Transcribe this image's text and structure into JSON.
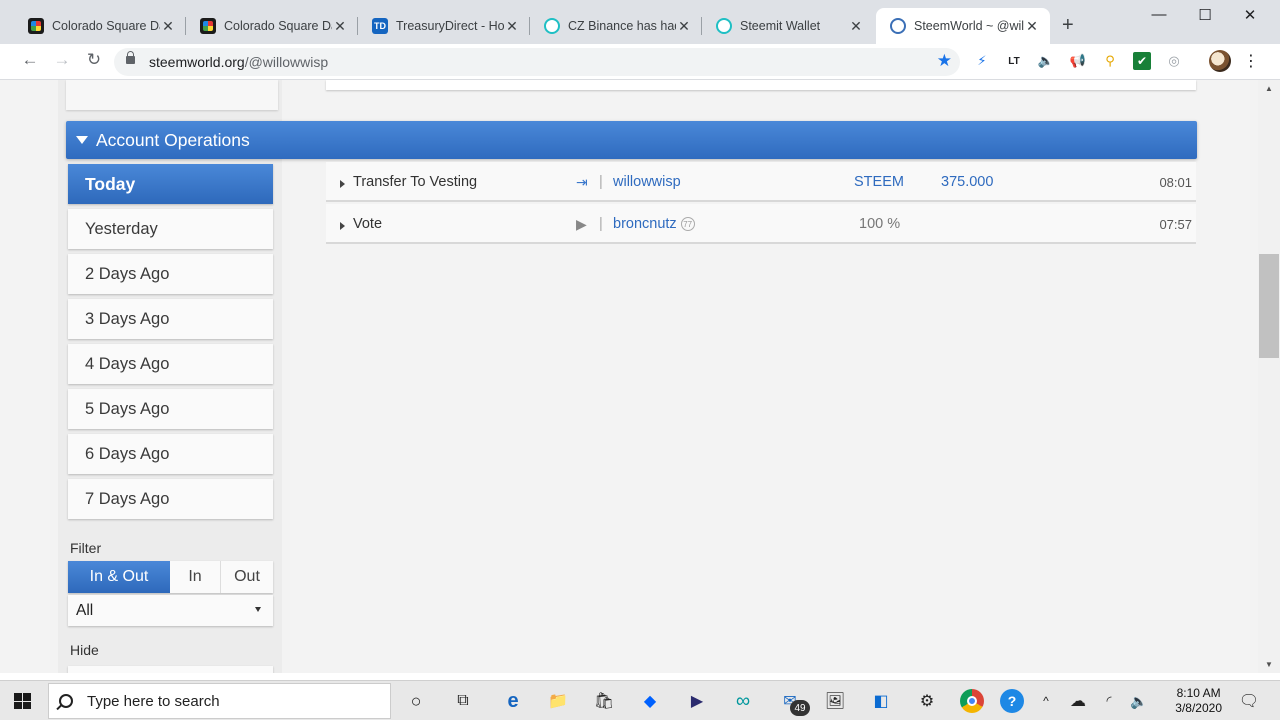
{
  "browser": {
    "tabs": [
      {
        "title": "Colorado Square Da",
        "favicon": "csd"
      },
      {
        "title": "Colorado Square Da",
        "favicon": "csd"
      },
      {
        "title": "TreasuryDirect - Hor",
        "favicon": "td"
      },
      {
        "title": "CZ Binance has had",
        "favicon": "steem"
      },
      {
        "title": "Steemit Wallet",
        "favicon": "steem"
      },
      {
        "title": "SteemWorld ~ @will",
        "favicon": "sw",
        "active": true
      }
    ],
    "td_badge": "TD",
    "url_host": "steemworld.org",
    "url_path": "/@willowwisp"
  },
  "page": {
    "section_title": "Account Operations",
    "days": [
      "Today",
      "Yesterday",
      "2 Days Ago",
      "3 Days Ago",
      "4 Days Ago",
      "5 Days Ago",
      "6 Days Ago",
      "7 Days Ago"
    ],
    "filter_label": "Filter",
    "filter_segments": [
      "In & Out",
      "In",
      "Out"
    ],
    "filter_select": "All",
    "hide_label": "Hide",
    "operations": [
      {
        "type": "Transfer To Vesting",
        "account": "willowwisp",
        "asset": "STEEM",
        "amount": "375.000",
        "time": "08:01"
      },
      {
        "type": "Vote",
        "account": "broncnutz",
        "reputation": "77",
        "percent": "100 %",
        "time": "07:57"
      }
    ]
  },
  "taskbar": {
    "search_placeholder": "Type here to search",
    "mail_badge": "49",
    "time": "8:10 AM",
    "date": "3/8/2020"
  },
  "colors": {
    "accent": "#3b78cc",
    "header_blue": "#2f6bbf"
  }
}
